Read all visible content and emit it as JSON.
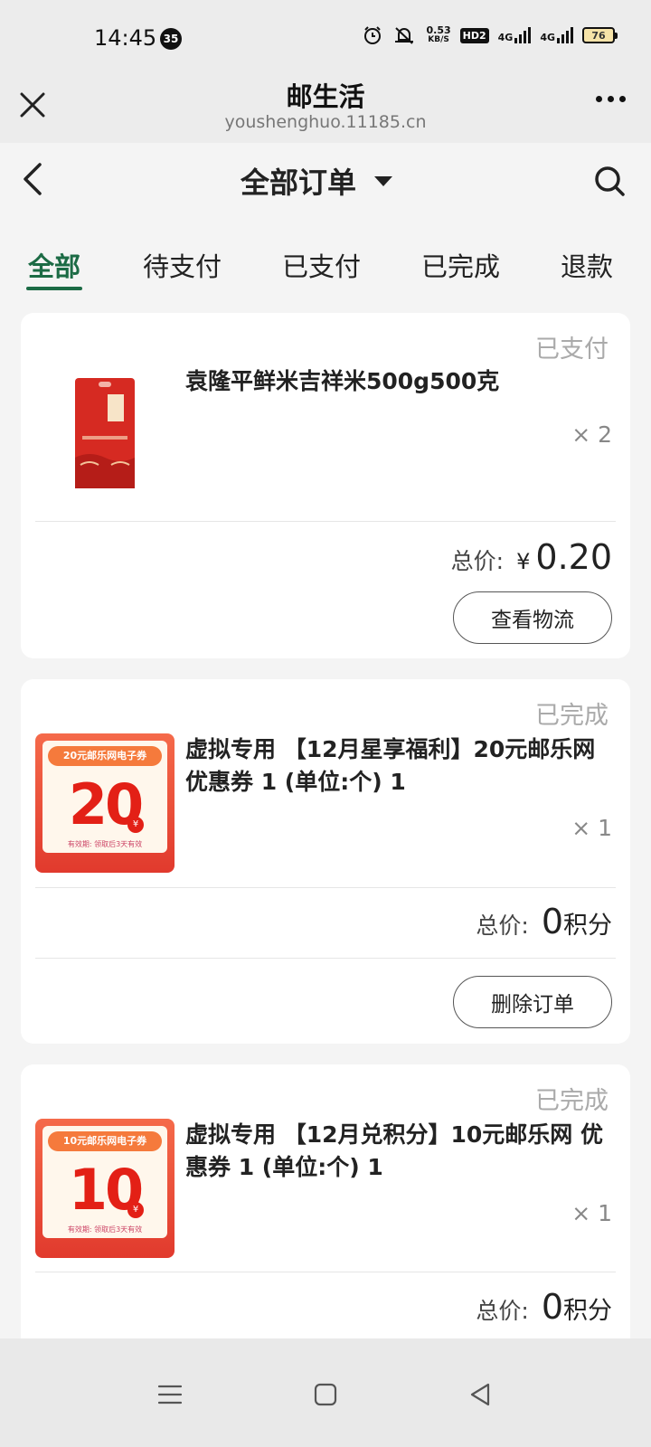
{
  "status_bar": {
    "time": "14:45",
    "notification_count": "35",
    "net_speed_value": "0.53",
    "net_speed_unit": "KB/S",
    "hd_label": "HD2",
    "sig1_label": "4G",
    "sig2_label": "4G",
    "battery": "76"
  },
  "webview": {
    "title": "邮生活",
    "url": "youshenghuo.11185.cn"
  },
  "nav": {
    "title": "全部订单"
  },
  "tabs": [
    {
      "label": "全部"
    },
    {
      "label": "待支付"
    },
    {
      "label": "已支付"
    },
    {
      "label": "已完成"
    },
    {
      "label": "退款"
    }
  ],
  "orders": [
    {
      "status": "已支付",
      "name": "袁隆平鲜米吉祥米500g500克",
      "qty": "× 2",
      "total_label": "总价:",
      "currency": "¥",
      "amount": "0.20",
      "action": "查看物流"
    },
    {
      "status": "已完成",
      "name": "虚拟专用 【12月星享福利】20元邮乐网 优惠券 1 (单位:个) 1",
      "qty": "× 1",
      "total_label": "总价:",
      "points": "0",
      "points_unit": "积分",
      "action": "删除订单",
      "coupon_tag": "20元邮乐网电子券",
      "coupon_value": "20",
      "coupon_yen": "¥",
      "coupon_note": "有效期: 领取后3天有效"
    },
    {
      "status": "已完成",
      "name": "虚拟专用 【12月兑积分】10元邮乐网 优惠券 1 (单位:个) 1",
      "qty": "× 1",
      "total_label": "总价:",
      "points": "0",
      "points_unit": "积分",
      "coupon_tag": "10元邮乐网电子券",
      "coupon_value": "10",
      "coupon_yen": "¥",
      "coupon_note": "有效期: 领取后3天有效"
    }
  ],
  "colors": {
    "accent": "#1c6b45",
    "coupon_red": "#e32016"
  }
}
